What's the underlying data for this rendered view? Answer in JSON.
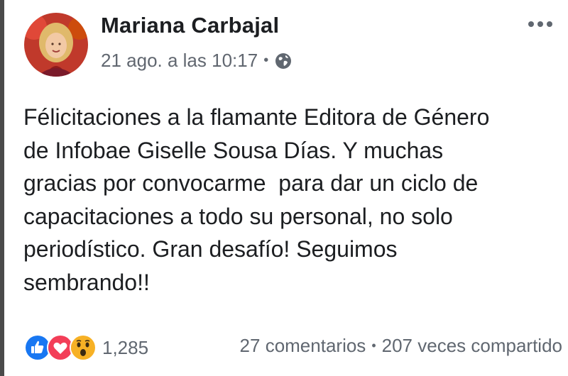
{
  "post": {
    "author": "Mariana Carbajal",
    "date": "21 ago. a las 10:17",
    "separator": "•",
    "privacy_icon": "globe-icon",
    "more_icon": "more-options-icon",
    "body_lines": [
      "Félicitaciones a la flamante Editora de Género",
      "de Infobae Giselle Sousa Días. Y muchas",
      "gracias por convocarme  para dar un ciclo de",
      "capacitaciones a todo su personal, no solo",
      "periodístico. Gran desafío! Seguimos",
      "sembrando!!"
    ]
  },
  "footer": {
    "reaction_icons": [
      "like-icon",
      "love-icon",
      "wow-icon"
    ],
    "reaction_count": "1,285",
    "comments": "27 comentarios",
    "separator": "•",
    "shares": "207 veces compartido"
  },
  "colors": {
    "like": "#1877f2",
    "love": "#f33e58",
    "wow": "#f7b125",
    "secondary_text": "#616770"
  }
}
